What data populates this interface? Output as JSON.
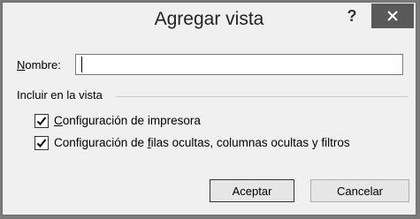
{
  "dialog": {
    "title": "Agregar vista",
    "help_label": "?"
  },
  "name_field": {
    "label_accesskey": "N",
    "label_rest": "ombre:",
    "value": ""
  },
  "group": {
    "label": "Incluir en la vista"
  },
  "options": [
    {
      "accesskey": "C",
      "rest": "onfiguración de impresora",
      "pre": "",
      "checked": true
    },
    {
      "pre": "Configuración de ",
      "accesskey": "f",
      "rest": "ilas ocultas, columnas ocultas y filtros",
      "checked": true
    }
  ],
  "buttons": {
    "ok": "Aceptar",
    "cancel": "Cancelar"
  },
  "colors": {
    "background": "#f0f0f0",
    "close_button": "#595959"
  },
  "icons": {
    "close": "close-icon",
    "check": "checkmark-icon"
  }
}
